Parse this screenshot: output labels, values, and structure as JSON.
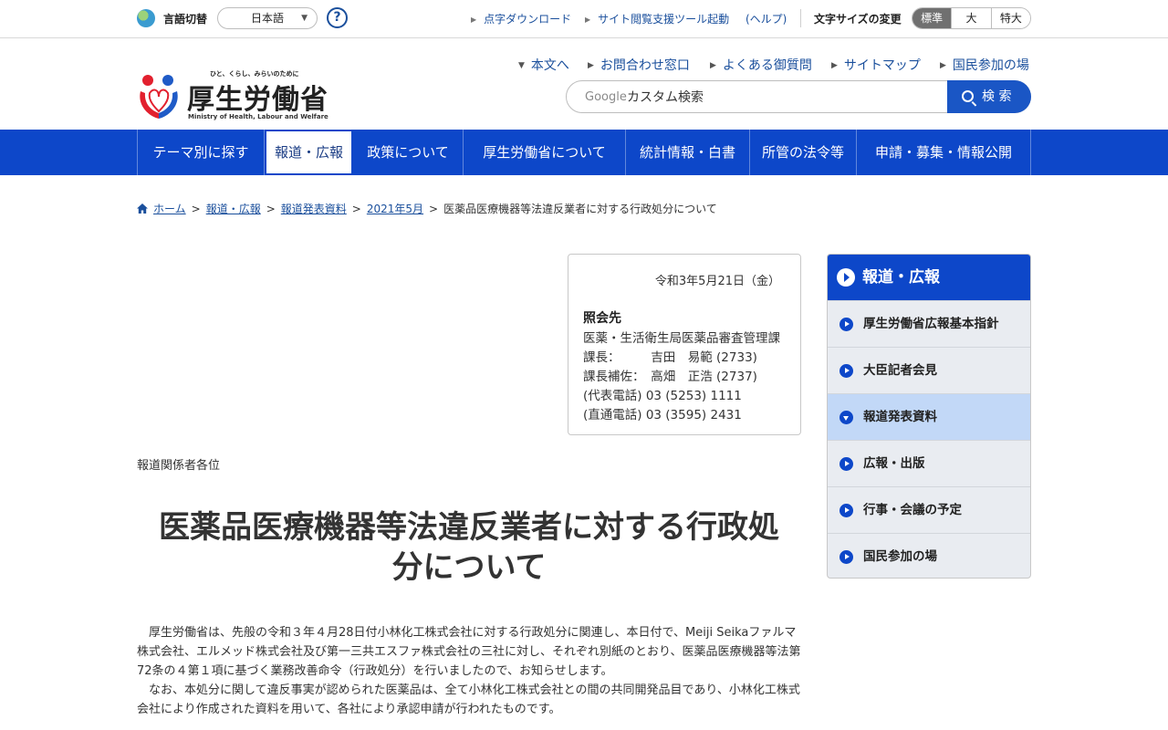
{
  "utility": {
    "language_label": "言語切替",
    "language_value": "日本語",
    "help_symbol": "?",
    "braille_download": "点字ダウンロード",
    "accessibility_tool": "サイト閲覧支援ツール起動",
    "help_link": "(ヘルプ)",
    "font_size_label": "文字サイズの変更",
    "font_sizes": [
      "標準",
      "大",
      "特大"
    ]
  },
  "logo": {
    "tagline": "ひと、くらし、みらいのために",
    "name": "厚生労働省",
    "english": "Ministry of Health, Labour and Welfare",
    "icon": "mhlw-logo-icon"
  },
  "header_links": [
    "本文へ",
    "お問合わせ窓口",
    "よくある御質問",
    "サイトマップ",
    "国民参加の場"
  ],
  "search": {
    "engine_label": "Google",
    "placeholder": "カスタム検索",
    "button_label": "検 索",
    "icon": "search-icon"
  },
  "main_nav": [
    "テーマ別に探す",
    "報道・広報",
    "政策について",
    "厚生労働省について",
    "統計情報・白書",
    "所管の法令等",
    "申請・募集・情報公開"
  ],
  "main_nav_active": "報道・広報",
  "breadcrumb": {
    "icon": "home-icon",
    "items": [
      "ホーム",
      "報道・広報",
      "報道発表資料",
      "2021年5月"
    ],
    "current": "医薬品医療機器等法違反業者に対する行政処分について"
  },
  "contact": {
    "date": "令和3年5月21日（金）",
    "heading": "照会先",
    "lines": [
      "医薬・生活衛生局医薬品審査管理課",
      "課長：　　　吉田　易範 (2733)",
      "課長補佐：　高畑　正浩 (2737)",
      "(代表電話) 03 (5253) 1111",
      "(直通電話) 03 (3595) 2431"
    ]
  },
  "article": {
    "addressee": "報道関係者各位",
    "title_line1": "医薬品医療機器等法違反業者に対する行政処",
    "title_line2": "分について",
    "paragraph1": "厚生労働省は、先般の令和３年４月28日付小林化工株式会社に対する行政処分に関連し、本日付で、Meiji Seikaファルマ株式会社、エルメッド株式会社及び第一三共エスファ株式会社の三社に対し、それぞれ別紙のとおり、医薬品医療機器等法第72条の４第１項に基づく業務改善命令（行政処分）を行いましたので、お知らせします。",
    "paragraph2": "なお、本処分に関して違反事実が認められた医薬品は、全て小林化工株式会社との間の共同開発品目であり、小林化工株式会社により作成された資料を用いて、各社により承認申請が行われたものです。"
  },
  "sidebar": {
    "heading": "報道・広報",
    "items": [
      "厚生労働省広報基本指針",
      "大臣記者会見",
      "報道発表資料",
      "広報・出版",
      "行事・会議の予定",
      "国民参加の場"
    ],
    "current": "報道発表資料"
  },
  "colors": {
    "primary": "#0d47c9",
    "link": "#1a4f9c",
    "sidebar_current": "#c2d8f7",
    "sidebar_bg": "#e9ecf1"
  }
}
